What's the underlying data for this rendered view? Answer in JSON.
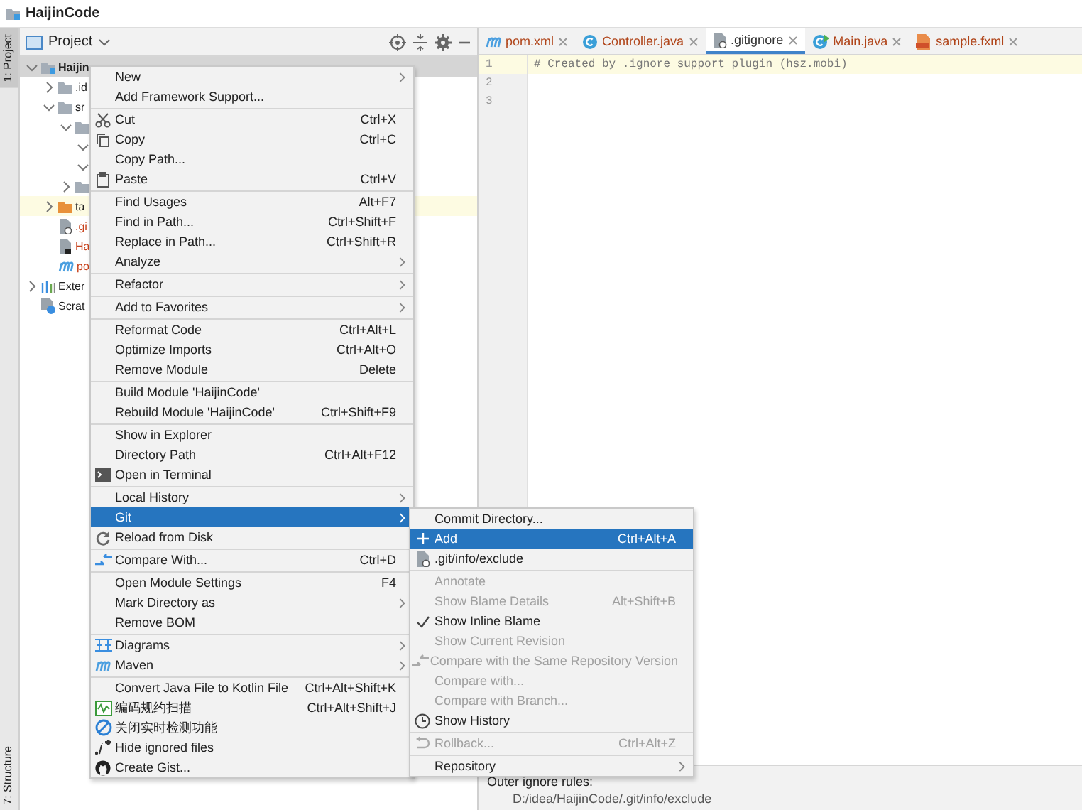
{
  "window": {
    "title": "HaijinCode"
  },
  "tool_strip": {
    "top": "1: Project",
    "bottom": "7: Structure"
  },
  "project_panel": {
    "title": "Project",
    "tree": [
      {
        "label": "Haijin",
        "kind": "module",
        "expanded": true,
        "selected": true,
        "children": [
          {
            "label": ".id",
            "kind": "folder",
            "expanded": false
          },
          {
            "label": "sr",
            "kind": "folder",
            "expanded": true,
            "children": [
              {
                "kind": "folder",
                "expanded": true,
                "children": [
                  {
                    "expanded": true
                  },
                  {
                    "expanded": true
                  }
                ]
              },
              {
                "kind": "folder",
                "expanded": false
              }
            ]
          },
          {
            "label": "ta",
            "kind": "excluded",
            "expanded": false,
            "highlighted": true
          },
          {
            "label": ".gi",
            "kind": "ignore"
          },
          {
            "label": "Ha",
            "kind": "iml"
          },
          {
            "label": "po",
            "kind": "maven"
          }
        ]
      },
      {
        "label": "Exter",
        "kind": "libraries",
        "expanded": false
      },
      {
        "label": "Scrat",
        "kind": "scratches"
      }
    ]
  },
  "editor": {
    "tabs": [
      {
        "label": "pom.xml",
        "kind": "maven",
        "selected": false
      },
      {
        "label": "Controller.java",
        "kind": "class",
        "selected": false
      },
      {
        "label": ".gitignore",
        "kind": "ignore",
        "selected": true
      },
      {
        "label": "Main.java",
        "kind": "main",
        "selected": false
      },
      {
        "label": "sample.fxml",
        "kind": "fxml",
        "selected": false
      }
    ],
    "lines": [
      {
        "number": "1",
        "text": "# Created by .ignore support plugin (hsz.mobi)",
        "current": true
      },
      {
        "number": "2",
        "current": false
      },
      {
        "number": "3",
        "current": false
      }
    ],
    "bottom_panel": {
      "heading": "Outer ignore rules:",
      "path": "D:/idea/HaijinCode/.git/info/exclude"
    }
  },
  "context_menu": {
    "groups": [
      [
        {
          "label": "New",
          "submenu": true
        },
        {
          "label": "Add Framework Support..."
        }
      ],
      [
        {
          "label": "Cut",
          "shortcut": "Ctrl+X",
          "kind": "cut"
        },
        {
          "label": "Copy",
          "shortcut": "Ctrl+C",
          "kind": "copy"
        },
        {
          "label": "Copy Path..."
        },
        {
          "label": "Paste",
          "shortcut": "Ctrl+V",
          "kind": "paste"
        }
      ],
      [
        {
          "label": "Find Usages",
          "shortcut": "Alt+F7"
        },
        {
          "label": "Find in Path...",
          "shortcut": "Ctrl+Shift+F"
        },
        {
          "label": "Replace in Path...",
          "shortcut": "Ctrl+Shift+R"
        },
        {
          "label": "Analyze",
          "submenu": true
        }
      ],
      [
        {
          "label": "Refactor",
          "submenu": true
        }
      ],
      [
        {
          "label": "Add to Favorites",
          "submenu": true
        }
      ],
      [
        {
          "label": "Reformat Code",
          "shortcut": "Ctrl+Alt+L"
        },
        {
          "label": "Optimize Imports",
          "shortcut": "Ctrl+Alt+O"
        },
        {
          "label": "Remove Module",
          "shortcut": "Delete"
        }
      ],
      [
        {
          "label": "Build Module 'HaijinCode'"
        },
        {
          "label": "Rebuild Module 'HaijinCode'",
          "shortcut": "Ctrl+Shift+F9"
        }
      ],
      [
        {
          "label": "Show in Explorer"
        },
        {
          "label": "Directory Path",
          "shortcut": "Ctrl+Alt+F12"
        },
        {
          "label": "Open in Terminal",
          "kind": "terminal"
        }
      ],
      [
        {
          "label": "Local History",
          "submenu": true
        },
        {
          "label": "Git",
          "submenu": true,
          "selected": true
        },
        {
          "label": "Reload from Disk",
          "kind": "reload"
        }
      ],
      [
        {
          "label": "Compare With...",
          "shortcut": "Ctrl+D",
          "kind": "compare"
        }
      ],
      [
        {
          "label": "Open Module Settings",
          "shortcut": "F4"
        },
        {
          "label": "Mark Directory as",
          "submenu": true
        },
        {
          "label": "Remove BOM"
        }
      ],
      [
        {
          "label": "Diagrams",
          "submenu": true,
          "kind": "diagrams"
        },
        {
          "label": "Maven",
          "submenu": true,
          "kind": "maven"
        }
      ],
      [
        {
          "label": "Convert Java File to Kotlin File",
          "shortcut": "Ctrl+Alt+Shift+K"
        },
        {
          "label": "编码规约扫描",
          "shortcut": "Ctrl+Alt+Shift+J",
          "kind": "scan"
        },
        {
          "label": "关闭实时检测功能",
          "kind": "forbid"
        },
        {
          "label": "Hide ignored files",
          "kind": "hide"
        },
        {
          "label": "Create Gist...",
          "kind": "github"
        }
      ]
    ]
  },
  "git_submenu": {
    "groups": [
      [
        {
          "label": "Commit Directory..."
        },
        {
          "label": "Add",
          "shortcut": "Ctrl+Alt+A",
          "kind": "plus",
          "selected": true
        },
        {
          "label": ".git/info/exclude",
          "kind": "ignore"
        }
      ],
      [
        {
          "label": "Annotate",
          "disabled": true
        },
        {
          "label": "Show Blame Details",
          "shortcut": "Alt+Shift+B",
          "disabled": true
        },
        {
          "label": "Show Inline Blame",
          "checked": true
        },
        {
          "label": "Show Current Revision",
          "disabled": true
        },
        {
          "label": "Compare with the Same Repository Version",
          "kind": "compare",
          "disabled": true
        },
        {
          "label": "Compare with...",
          "disabled": true
        },
        {
          "label": "Compare with Branch...",
          "disabled": true
        },
        {
          "label": "Show History",
          "kind": "history"
        }
      ],
      [
        {
          "label": "Rollback...",
          "shortcut": "Ctrl+Alt+Z",
          "kind": "rollback",
          "disabled": true
        }
      ],
      [
        {
          "label": "Repository",
          "submenu": true
        }
      ]
    ]
  }
}
